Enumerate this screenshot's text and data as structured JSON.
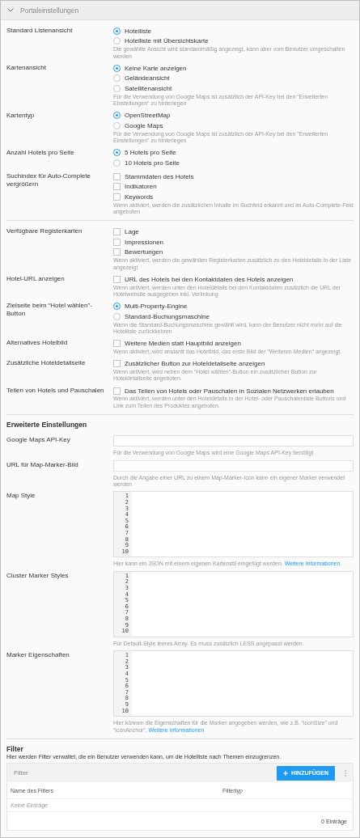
{
  "panel": {
    "title": "Portaleinstellungen",
    "expanded": true
  },
  "groups": [
    {
      "rows": [
        {
          "kind": "radio",
          "label": "Standard Listenansicht",
          "options": [
            {
              "label": "Hotelliste",
              "selected": true
            },
            {
              "label": "Hotelliste mit Übersichtskarte",
              "selected": false
            }
          ],
          "hint": "Die gewählte Ansicht wird standardmäßig angezeigt, kann aber vom Benutzer umgeschalten werden"
        },
        {
          "kind": "radio",
          "label": "Kartenansicht",
          "options": [
            {
              "label": "Keine Karte anzeigen",
              "selected": true
            },
            {
              "label": "Geländeansicht",
              "selected": false
            },
            {
              "label": "Satellitenansicht",
              "selected": false
            }
          ],
          "hint": "Für die Verwendung von Google Maps ist zusätzlich der API-Key bei den \"Erweiterten Einstellungen\" zu hinterlegen"
        },
        {
          "kind": "radio",
          "label": "Kartentyp",
          "options": [
            {
              "label": "OpenStreetMap",
              "selected": true
            },
            {
              "label": "Google Maps",
              "selected": false
            }
          ],
          "hint": "Für die Verwendung von Google Maps ist zusätzlich der API-Key bei den \"Erweiterten Einstellungen\" zu hinterlegen"
        },
        {
          "kind": "radio",
          "label": "Anzahl Hotels pro Seite",
          "options": [
            {
              "label": "5 Hotels pro Seite",
              "selected": true
            },
            {
              "label": "10 Hotels pro Seite",
              "selected": false
            }
          ]
        },
        {
          "kind": "checkbox",
          "label": "Suchindex für Auto-Complete vergrößern",
          "options": [
            {
              "label": "Stammdaten des Hotels",
              "checked": false
            },
            {
              "label": "Indikatoren",
              "checked": false
            },
            {
              "label": "Keywords",
              "checked": false
            }
          ],
          "hint": "Wenn aktiviert, werden die zusätzlichen Inhalte im Suchfeld erkannt und im Auto-Complete-Feld angeboten"
        }
      ]
    },
    {
      "rows": [
        {
          "kind": "checkbox",
          "label": "Verfügbare Registerkarten",
          "options": [
            {
              "label": "Lage",
              "checked": false
            },
            {
              "label": "Impressionen",
              "checked": false
            },
            {
              "label": "Bewertungen",
              "checked": false
            }
          ],
          "hint": "Wenn aktiviert, werden die gewählten Registerkarten zusätzlich zu den Hoteldetails in der Liste angezeigt"
        },
        {
          "kind": "checkbox",
          "label": "Hotel-URL anzeigen",
          "options": [
            {
              "label": "URL des Hotels bei den Kontaktdaten des Hotels anzeigen",
              "checked": false
            }
          ],
          "hint": "Wenn aktiviert, werden unter den Hoteldetails bei den Kontaktdaten zusätzlich die URL der Hotelwebsite ausgegeben inkl. Verlinkung"
        },
        {
          "kind": "radio",
          "label": "Zielseite beim “Hotel wählen”-Button",
          "options": [
            {
              "label": "Multi-Property-Engine",
              "selected": true
            },
            {
              "label": "Standard-Buchungsmaschine",
              "selected": false
            }
          ],
          "hint": "Wenn die Standard-Buchungsmaschine gewählt wird, kann der Benutzer nicht mehr auf die Hotelliste zurückkehren"
        },
        {
          "kind": "checkbox",
          "label": "Alternatives Hotelbild",
          "options": [
            {
              "label": "Weitere Medien statt Hauptbild anzeigen",
              "checked": false
            }
          ],
          "hint": "Wenn aktiviert, wird anstantt das Hotelbild, das erste Bild der “Weiteren Medien” angezeigt."
        },
        {
          "kind": "checkbox",
          "label": "Zusätzliche Hoteldetailseite",
          "options": [
            {
              "label": "Zusätzlicher Button zur Hoteldetailseite anzeigen",
              "checked": false
            }
          ],
          "hint": "Wenn aktiviert, wird neben dem “Hotel wählen”-Button ein zusätzlicher Button zur Hoteldetailseite angeboten."
        },
        {
          "kind": "checkbox",
          "label": "Teilen von Hotels und Pauschalen",
          "options": [
            {
              "label": "Das Teilen von Hotels oder Pauschalen in Sozialen Netzwerken erlauben",
              "checked": false
            }
          ],
          "hint": "Wenn aktiviert, werden unter den Hoteldetails in der Hotel- oder Pauschalenliste Buttons und Link zum Teilen des Produktes angeboten."
        }
      ]
    }
  ],
  "advanced": {
    "heading": "Erweiterte Einstellungen",
    "rows": [
      {
        "kind": "text",
        "label": "Google Maps API-Key",
        "hint": "Für die Verwendung von Google Maps wird eine Google Maps API-Key benötigt"
      },
      {
        "kind": "text",
        "label": "URL für Map-Marker-Bild",
        "hint": "Durch die Angabe einer URL zu einem Map-Marker-Icon kann ein eigener Marker verwendet werden"
      },
      {
        "kind": "code",
        "label": "Map Style",
        "line_numbers": [
          "1",
          "2",
          "3",
          "4",
          "5",
          "6",
          "7",
          "8",
          "9",
          "10"
        ],
        "hint": "Hier kann ein JSON mit einem eigenen Kartenstil eingefügt werden.",
        "link": "Weitere Informationen."
      },
      {
        "kind": "code",
        "label": "Cluster Marker Styles",
        "line_numbers": [
          "1",
          "2",
          "3",
          "4",
          "5",
          "6",
          "7",
          "8",
          "9",
          "10"
        ],
        "hint": "Für Default-Style leeres Array. Es muss zusätzlich LESS angepasst werden."
      },
      {
        "kind": "code",
        "label": "Marker Eigenschaften",
        "line_numbers": [
          "1",
          "2",
          "3",
          "4",
          "5",
          "6",
          "7",
          "8",
          "9",
          "10"
        ],
        "hint": "Hier können die Eigenschaften für die Marker angegeben werden, wie z.B. “iconSize” und “iconAnchor”.",
        "link": "Weitere Informationen"
      }
    ]
  },
  "filter": {
    "heading": "Filter",
    "description": "Hier werden Filter verwaltet, die ein Benutzer verwenden kann, um die Hotelliste nach Themen einzugrenzen.",
    "table_title": "Filter",
    "add_button": "HINZUFÜGEN",
    "columns": [
      "Name des Filters",
      "Filtertyp"
    ],
    "empty_text": "Keine Einträge",
    "count": "0 Einträge"
  }
}
